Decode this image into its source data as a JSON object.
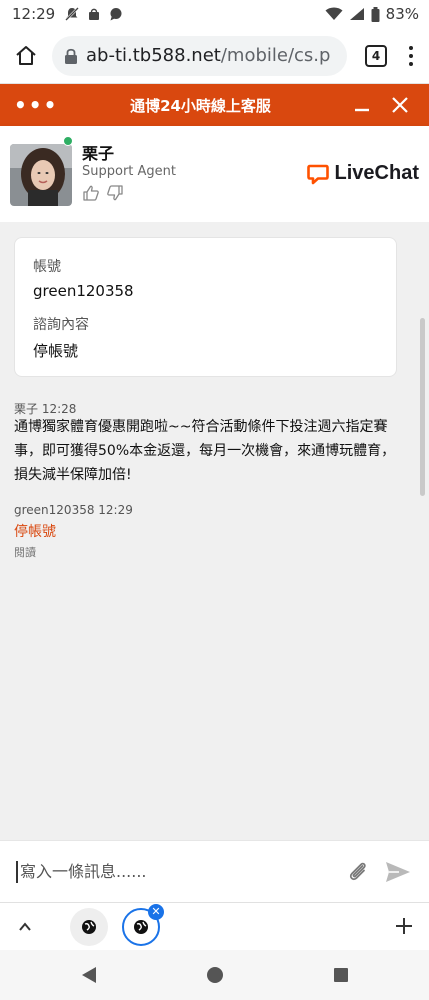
{
  "status_bar": {
    "time": "12:29",
    "battery": "83%"
  },
  "browser": {
    "url_host": "ab-ti.tb588.net",
    "url_path": "/mobile/cs.p",
    "tab_count": "4"
  },
  "chat": {
    "header_dots": "•••",
    "title": "通博24小時線上客服"
  },
  "agent": {
    "name": "栗子",
    "role": "Support Agent",
    "brand": "LiveChat"
  },
  "form": {
    "account_label": "帳號",
    "account_value": "green120358",
    "inquiry_label": "諮詢內容",
    "inquiry_value": "停帳號"
  },
  "messages": [
    {
      "meta": "栗子 12:28",
      "text": "通博獨家體育優惠開跑啦~~符合活動條件下投注週六指定賽事，即可獲得50%本金返還，每月一次機會，來通博玩體育，損失減半保障加倍!"
    },
    {
      "meta": "green120358 12:29",
      "text": "停帳號",
      "status": "閱讀"
    }
  ],
  "input": {
    "placeholder": "寫入一條訊息......"
  },
  "colors": {
    "accent": "#d9480f",
    "online": "#2eae63",
    "tab_active": "#1a73e8"
  }
}
